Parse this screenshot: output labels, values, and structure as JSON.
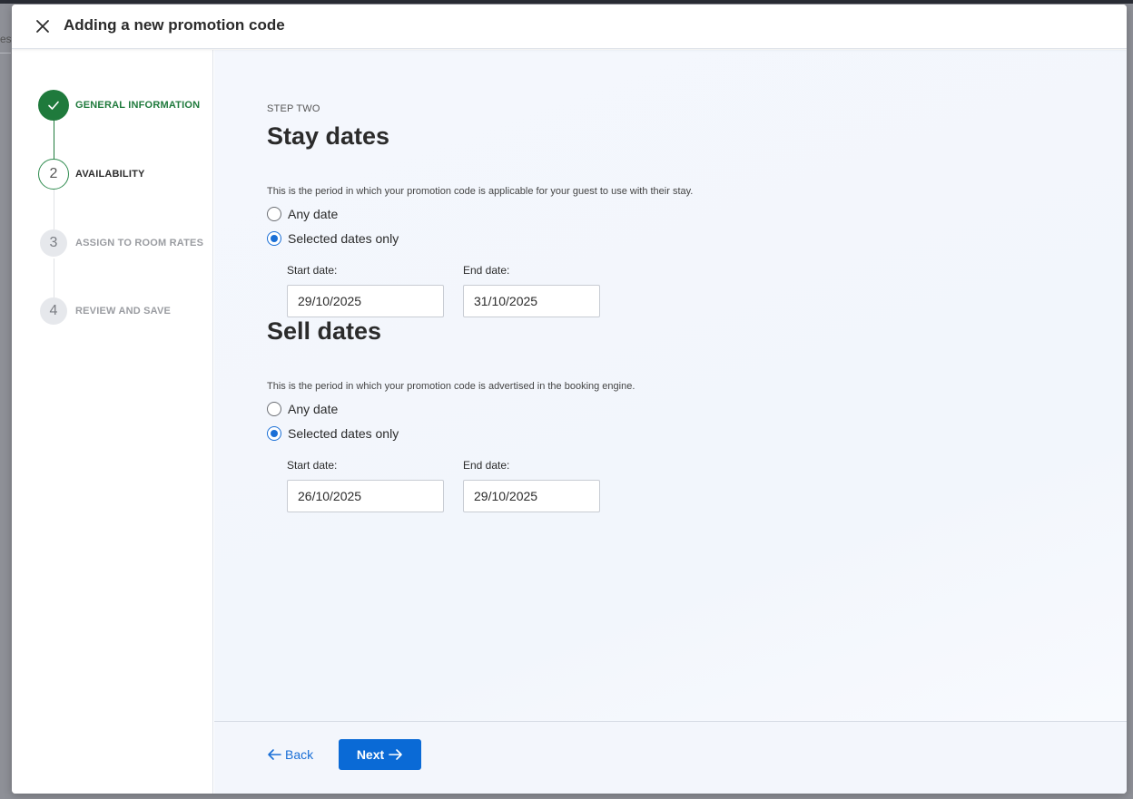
{
  "header": {
    "title": "Adding a new promotion code"
  },
  "background": {
    "peek_text": "es"
  },
  "steps": [
    {
      "number": "1",
      "label": "GENERAL INFORMATION",
      "status": "done"
    },
    {
      "number": "2",
      "label": "AVAILABILITY",
      "status": "current"
    },
    {
      "number": "3",
      "label": "ASSIGN TO ROOM RATES",
      "status": "todo"
    },
    {
      "number": "4",
      "label": "REVIEW AND SAVE",
      "status": "todo"
    }
  ],
  "main": {
    "eyebrow": "STEP TWO",
    "stay": {
      "title": "Stay dates",
      "description": "This is the period in which your promotion code is applicable for your guest to use with their stay.",
      "options": [
        "Any date",
        "Selected dates only"
      ],
      "selected": "Selected dates only",
      "start_label": "Start date:",
      "start_value": "29/10/2025",
      "end_label": "End date:",
      "end_value": "31/10/2025"
    },
    "sell": {
      "title": "Sell dates",
      "description": "This is the period in which your promotion code is advertised in the booking engine.",
      "options": [
        "Any date",
        "Selected dates only"
      ],
      "selected": "Selected dates only",
      "start_label": "Start date:",
      "start_value": "26/10/2025",
      "end_label": "End date:",
      "end_value": "29/10/2025"
    }
  },
  "footer": {
    "back_label": "Back",
    "next_label": "Next"
  },
  "colors": {
    "accent": "#0a6ad6",
    "success": "#1f7a3c",
    "background": "#f3f6fc"
  }
}
